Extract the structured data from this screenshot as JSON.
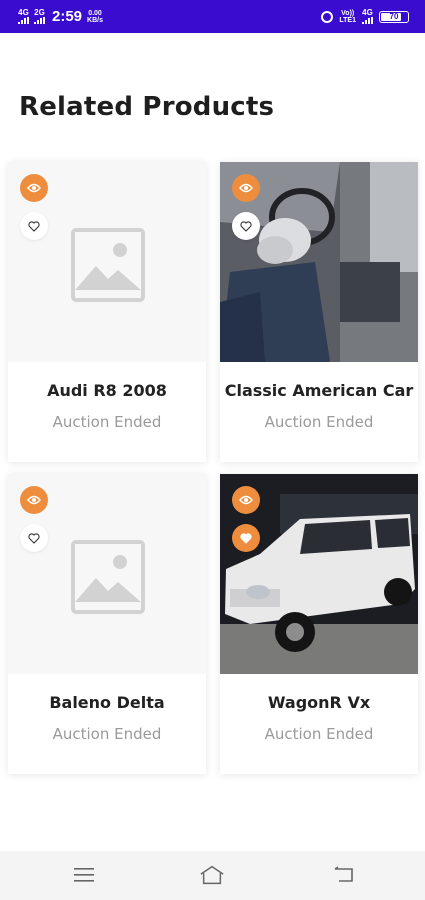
{
  "status_bar": {
    "network1": "4G",
    "network2": "2G",
    "time": "2:59",
    "speed_value": "0.00",
    "speed_unit": "KB/s",
    "volte1": "Vo))",
    "volte2": "LTE1",
    "network3": "4G",
    "battery": "70"
  },
  "page": {
    "title": "Related Products"
  },
  "products": [
    {
      "name": "Audi R8 2008",
      "status": "Auction Ended",
      "image": "placeholder-image",
      "favorited": false
    },
    {
      "name": "Classic American Car",
      "status": "Auction Ended",
      "image": "car-interior-airbag-photo",
      "favorited": false
    },
    {
      "name": "Baleno Delta",
      "status": "Auction Ended",
      "image": "placeholder-image",
      "favorited": false
    },
    {
      "name": "WagonR Vx",
      "status": "Auction Ended",
      "image": "white-suv-photo",
      "favorited": true
    }
  ],
  "colors": {
    "status_bar": "#3a0ccf",
    "accent": "#ef8d3f",
    "title": "#1e1e1e",
    "muted": "#9a9a9a"
  },
  "icons": [
    "eye-icon",
    "heart-icon",
    "menu-icon",
    "home-icon",
    "back-icon"
  ]
}
